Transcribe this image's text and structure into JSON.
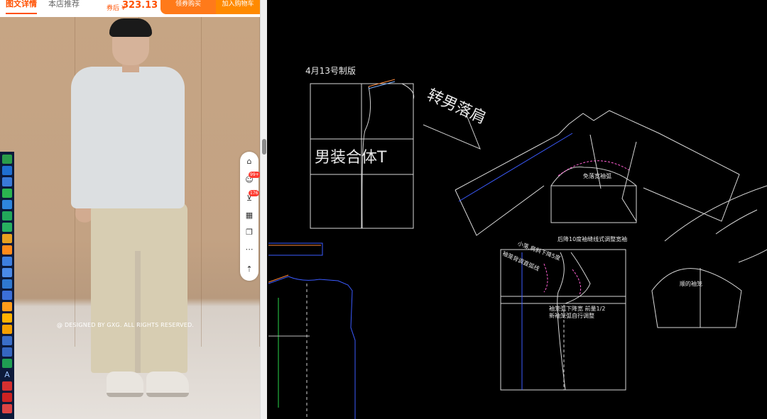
{
  "shop": {
    "tabs": [
      {
        "label": "图文详情",
        "active": true
      },
      {
        "label": "本店推荐",
        "active": false
      }
    ],
    "price": {
      "prefix": "券后 ¥",
      "value": "323.13"
    },
    "buttons": {
      "coupon": "领券购买",
      "cart": "加入购物车"
    },
    "caption": "@ DESIGNED BY GXG. ALL RIGHTS RESERVED.",
    "badges": {
      "messages": "99+",
      "cart": "176"
    },
    "side_action_icons": [
      "shop-icon",
      "chat-icon",
      "cart-icon",
      "grid-icon",
      "copy-icon",
      "more-icon",
      "back-to-top-icon"
    ]
  },
  "cad": {
    "labels": {
      "date_note": "4月13号制版",
      "fitted_tee": "男装合体T",
      "convert_title": "转男落肩",
      "sleeve_note": "免落宽袖弧",
      "back_note": "后降10度袖缝线式调整宽袖",
      "shoulder_note": "小落,肩斜下降5度",
      "side_note": "袖笼背调直弧线",
      "hem_note_1": "袖笼弧下降宽 前量1/2",
      "hem_note_2": "新袖笼弧自行调整",
      "small_sleeve_note": "顺的袖笼"
    }
  },
  "colors": {
    "accent": "#ff5000",
    "cad_line": "#d8d8d8",
    "cad_blue": "#3b5bff",
    "cad_pink": "#ff5fd2",
    "cad_green": "#2ad64a"
  }
}
